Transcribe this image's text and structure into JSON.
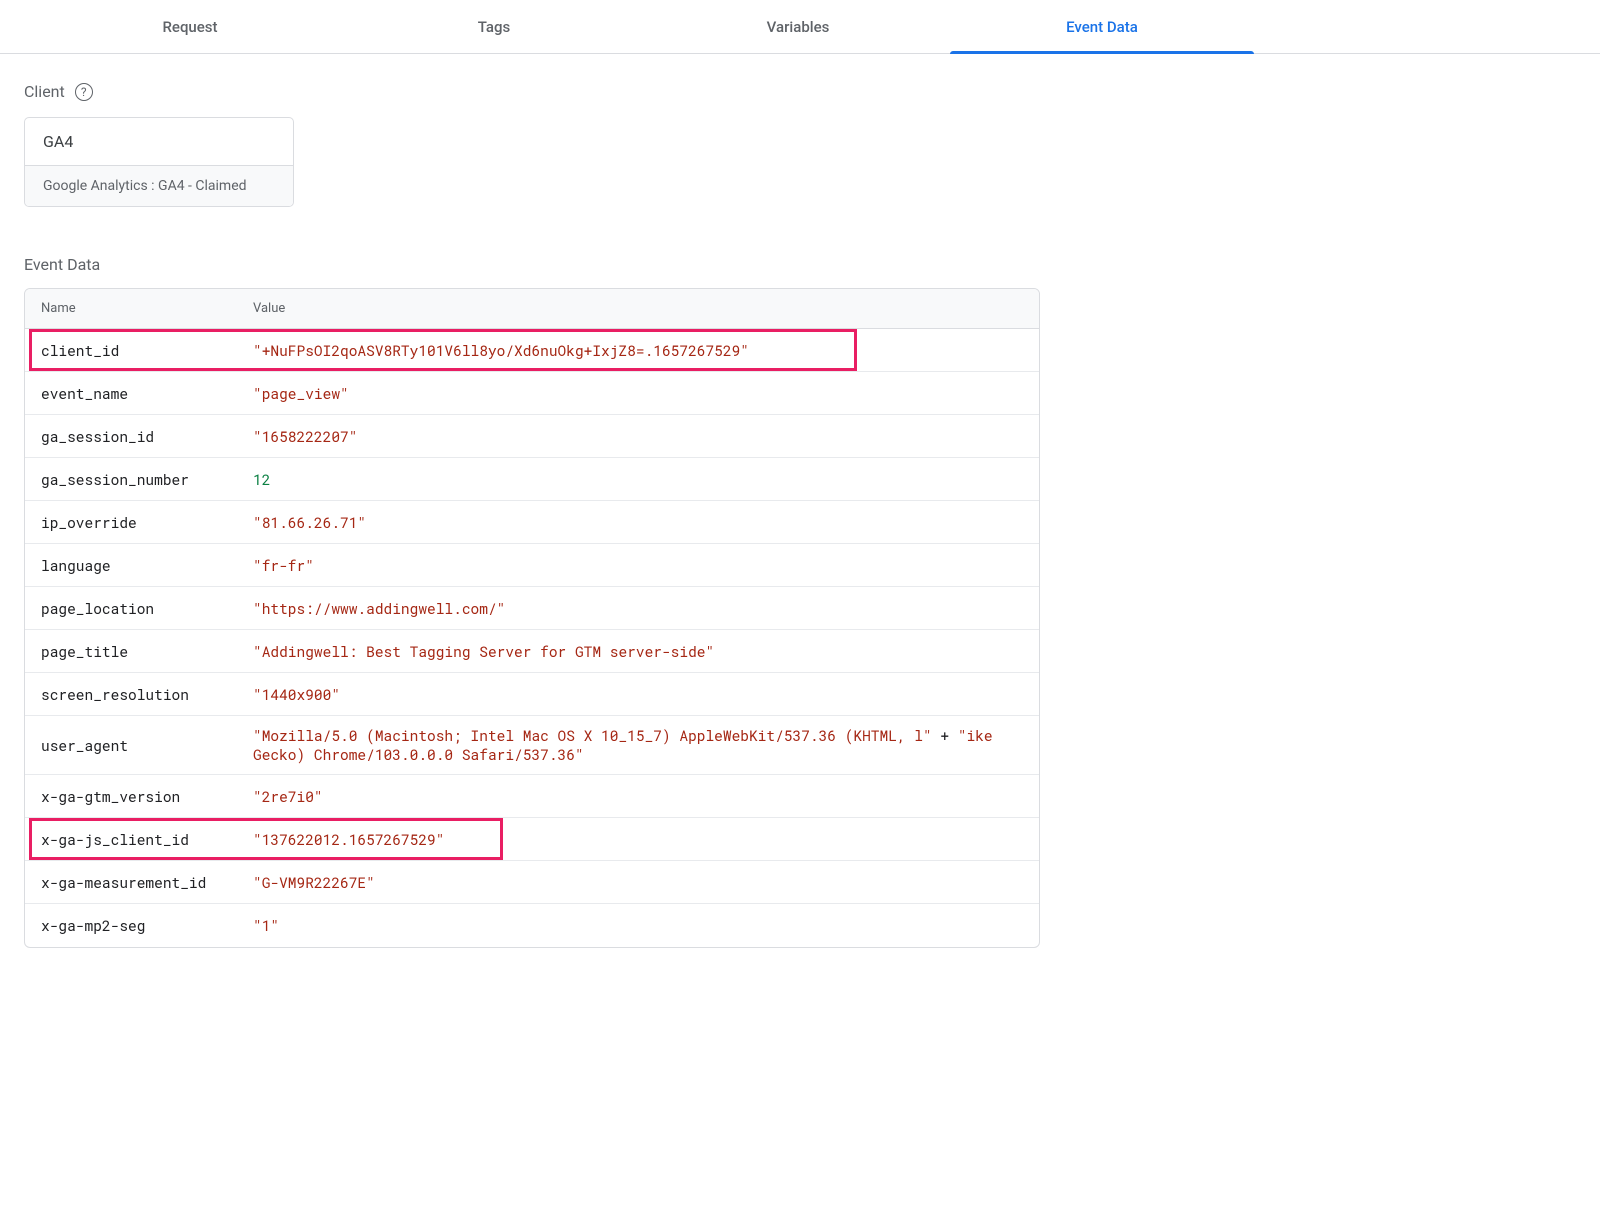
{
  "tabs": [
    {
      "label": "Request",
      "active": false
    },
    {
      "label": "Tags",
      "active": false
    },
    {
      "label": "Variables",
      "active": false
    },
    {
      "label": "Event Data",
      "active": true
    }
  ],
  "client_section": {
    "label": "Client",
    "card_title": "GA4",
    "card_sub": "Google Analytics : GA4 - Claimed"
  },
  "event_data": {
    "section_label": "Event Data",
    "col_name": "Name",
    "col_value": "Value",
    "rows": [
      {
        "name": "client_id",
        "value": "\"+NuFPsOI2qoASV8RTy101V6ll8yo/Xd6nuOkg+IxjZ8=.1657267529\"",
        "type": "string",
        "highlight": true,
        "hl_width": 828
      },
      {
        "name": "event_name",
        "value": "\"page_view\"",
        "type": "string"
      },
      {
        "name": "ga_session_id",
        "value": "\"1658222207\"",
        "type": "string"
      },
      {
        "name": "ga_session_number",
        "value": "12",
        "type": "number"
      },
      {
        "name": "ip_override",
        "value": "\"81.66.26.71\"",
        "type": "string"
      },
      {
        "name": "language",
        "value": "\"fr-fr\"",
        "type": "string"
      },
      {
        "name": "page_location",
        "value": "\"https://www.addingwell.com/\"",
        "type": "string"
      },
      {
        "name": "page_title",
        "value": "\"Addingwell: Best Tagging Server for GTM server-side\"",
        "type": "string"
      },
      {
        "name": "screen_resolution",
        "value": "\"1440x900\"",
        "type": "string"
      },
      {
        "name": "user_agent",
        "value": "\"Mozilla/5.0 (Macintosh; Intel Mac OS X 10_15_7) AppleWebKit/537.36 (KHTML, l\" + \"ike Gecko) Chrome/103.0.0.0 Safari/537.36\"",
        "type": "concat"
      },
      {
        "name": "x-ga-gtm_version",
        "value": "\"2re7i0\"",
        "type": "string"
      },
      {
        "name": "x-ga-js_client_id",
        "value": "\"137622012.1657267529\"",
        "type": "string",
        "highlight": true,
        "hl_width": 474
      },
      {
        "name": "x-ga-measurement_id",
        "value": "\"G-VM9R22267E\"",
        "type": "string"
      },
      {
        "name": "x-ga-mp2-seg",
        "value": "\"1\"",
        "type": "string"
      }
    ]
  }
}
